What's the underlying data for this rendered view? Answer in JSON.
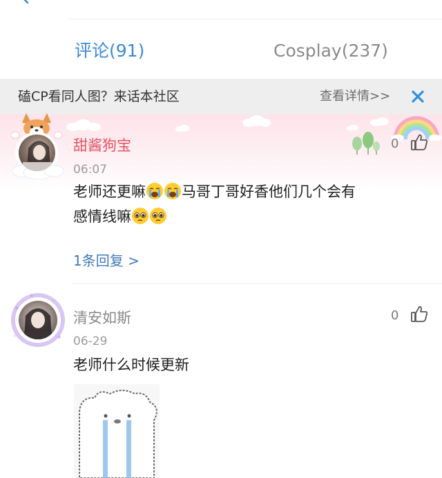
{
  "tabs": [
    {
      "label": "评论(91)",
      "active": true
    },
    {
      "label": "Cosplay(237)",
      "active": false
    }
  ],
  "promo": {
    "text": "磕CP看同人图？来话本社区",
    "link_label": "查看详情>>"
  },
  "comments": [
    {
      "username": "甜酱狗宝",
      "time": "06:07",
      "text_line1_a": "老师还更嘛",
      "text_line1_b": "马哥丁哥好香他们几个会有",
      "text_line2": "感情线嘛",
      "likes": "0",
      "reply_label": "1条回复 >",
      "username_color": "#e5525f"
    },
    {
      "username": "清安如斯",
      "time": "06-29",
      "text": "老师什么时候更新",
      "likes": "0",
      "username_color": "#8a8a8a"
    }
  ],
  "colors": {
    "accent": "#3b8ad8",
    "close_icon": "#2b8fe0"
  }
}
